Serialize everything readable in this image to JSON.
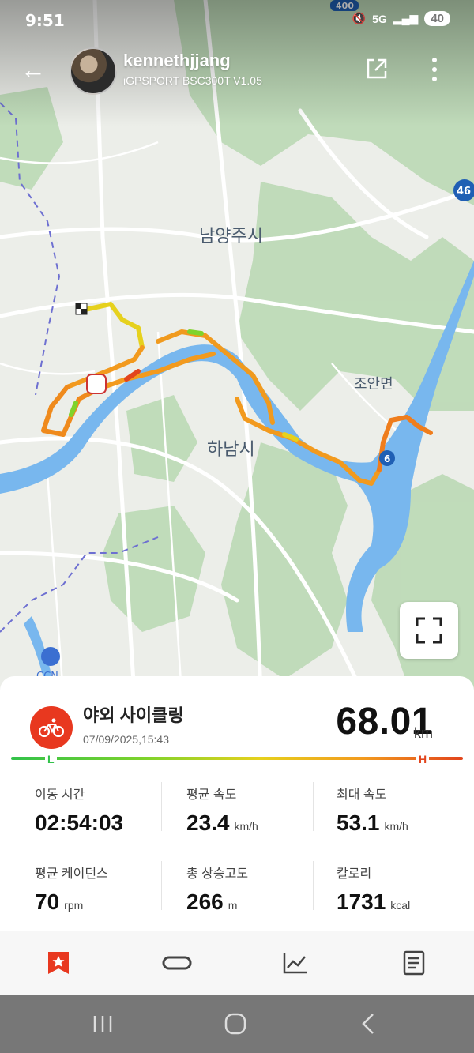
{
  "status_bar": {
    "time": "9:51",
    "network": "5G",
    "battery": "40"
  },
  "header": {
    "username": "kennethjjang",
    "device": "iGPSPORT BSC300T  V1.05"
  },
  "map": {
    "labels": {
      "city1": "남양주시",
      "city2": "하남시",
      "town": "조안면",
      "code1": "CCN"
    },
    "road_badges": [
      "400",
      "46",
      "6"
    ]
  },
  "activity": {
    "type": "야외 사이클링",
    "datetime": "07/09/2025,15:43",
    "distance": "68.01",
    "distance_unit": "km",
    "scale_low": "L",
    "scale_high": "H"
  },
  "stats": [
    {
      "label": "이동 시간",
      "value": "02:54:03",
      "unit": ""
    },
    {
      "label": "평균 속도",
      "value": "23.4",
      "unit": "km/h"
    },
    {
      "label": "최대 속도",
      "value": "53.1",
      "unit": "km/h"
    },
    {
      "label": "평균 케이던스",
      "value": "70",
      "unit": "rpm"
    },
    {
      "label": "총 상승고도",
      "value": "266",
      "unit": "m"
    },
    {
      "label": "칼로리",
      "value": "1731",
      "unit": "kcal"
    }
  ],
  "colors": {
    "accent": "#e8381f",
    "route_slow": "#32c24a",
    "route_fast": "#e2441c",
    "water": "#4a9ee8"
  }
}
